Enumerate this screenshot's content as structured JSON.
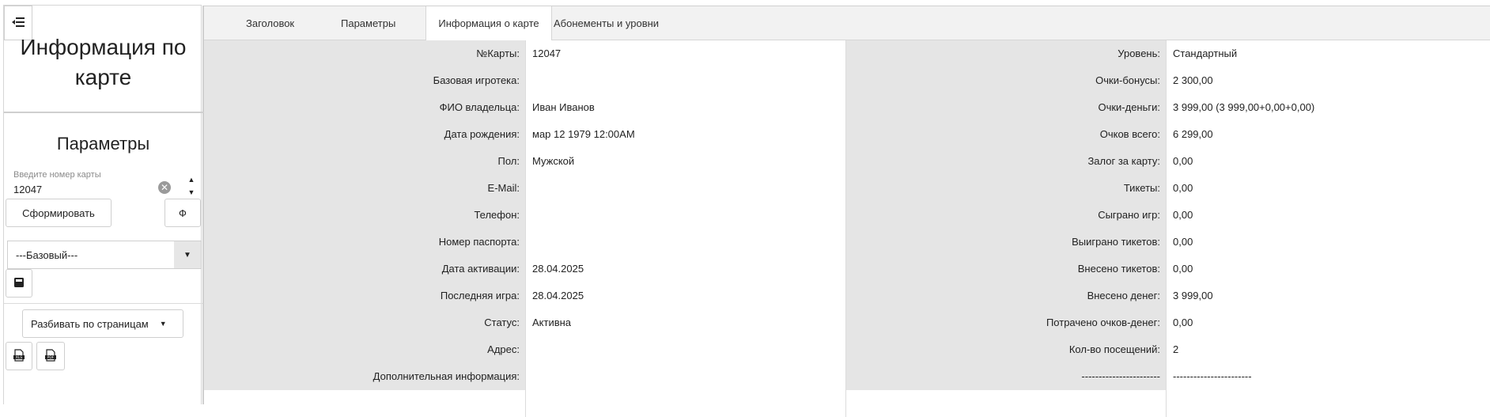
{
  "sidebar": {
    "title": "Информация по карте",
    "params_title": "Параметры",
    "card_input": {
      "label": "Введите номер карты",
      "value": "12047"
    },
    "generate_button": "Сформировать",
    "filter_button": "Ф",
    "level_select": {
      "selected": "---Базовый---"
    },
    "pagination_button": "Разбивать по страницам"
  },
  "tabs": [
    {
      "label": "Заголовок",
      "active": false
    },
    {
      "label": "Параметры",
      "active": false
    },
    {
      "label": "Информация о карте",
      "active": true
    },
    {
      "label": "Абонементы и уровни",
      "active": false
    }
  ],
  "rows": [
    {
      "l1": "№Карты:",
      "v1": "12047",
      "l2": "Уровень:",
      "v2": "Стандартный"
    },
    {
      "l1": "Базовая игротека:",
      "v1": "",
      "l2": "Очки-бонусы:",
      "v2": "2 300,00"
    },
    {
      "l1": "ФИО владельца:",
      "v1": "Иван Иванов",
      "l2": "Очки-деньги:",
      "v2": "3 999,00 (3 999,00+0,00+0,00)"
    },
    {
      "l1": "Дата рождения:",
      "v1": "мар 12 1979 12:00AM",
      "l2": "Очков всего:",
      "v2": "6 299,00"
    },
    {
      "l1": "Пол:",
      "v1": "Мужской",
      "l2": "Залог за карту:",
      "v2": "0,00"
    },
    {
      "l1": "E-Mail:",
      "v1": "",
      "l2": "Тикеты:",
      "v2": "0,00"
    },
    {
      "l1": "Телефон:",
      "v1": "",
      "l2": "Сыграно игр:",
      "v2": "0,00"
    },
    {
      "l1": "Номер паспорта:",
      "v1": "",
      "l2": "Выиграно тикетов:",
      "v2": "0,00"
    },
    {
      "l1": "Дата активации:",
      "v1": "28.04.2025",
      "l2": "Внесено тикетов:",
      "v2": "0,00"
    },
    {
      "l1": "Последняя игра:",
      "v1": "28.04.2025",
      "l2": "Внесено денег:",
      "v2": "3 999,00"
    },
    {
      "l1": "Статус:",
      "v1": "Активна",
      "l2": "Потрачено очков-денег:",
      "v2": "0,00"
    },
    {
      "l1": "Адрес:",
      "v1": "",
      "l2": "Кол-во посещений:",
      "v2": "2"
    },
    {
      "l1": "Дополнительная информация:",
      "v1": "",
      "l2": "-----------------------",
      "v2": "-----------------------"
    }
  ]
}
